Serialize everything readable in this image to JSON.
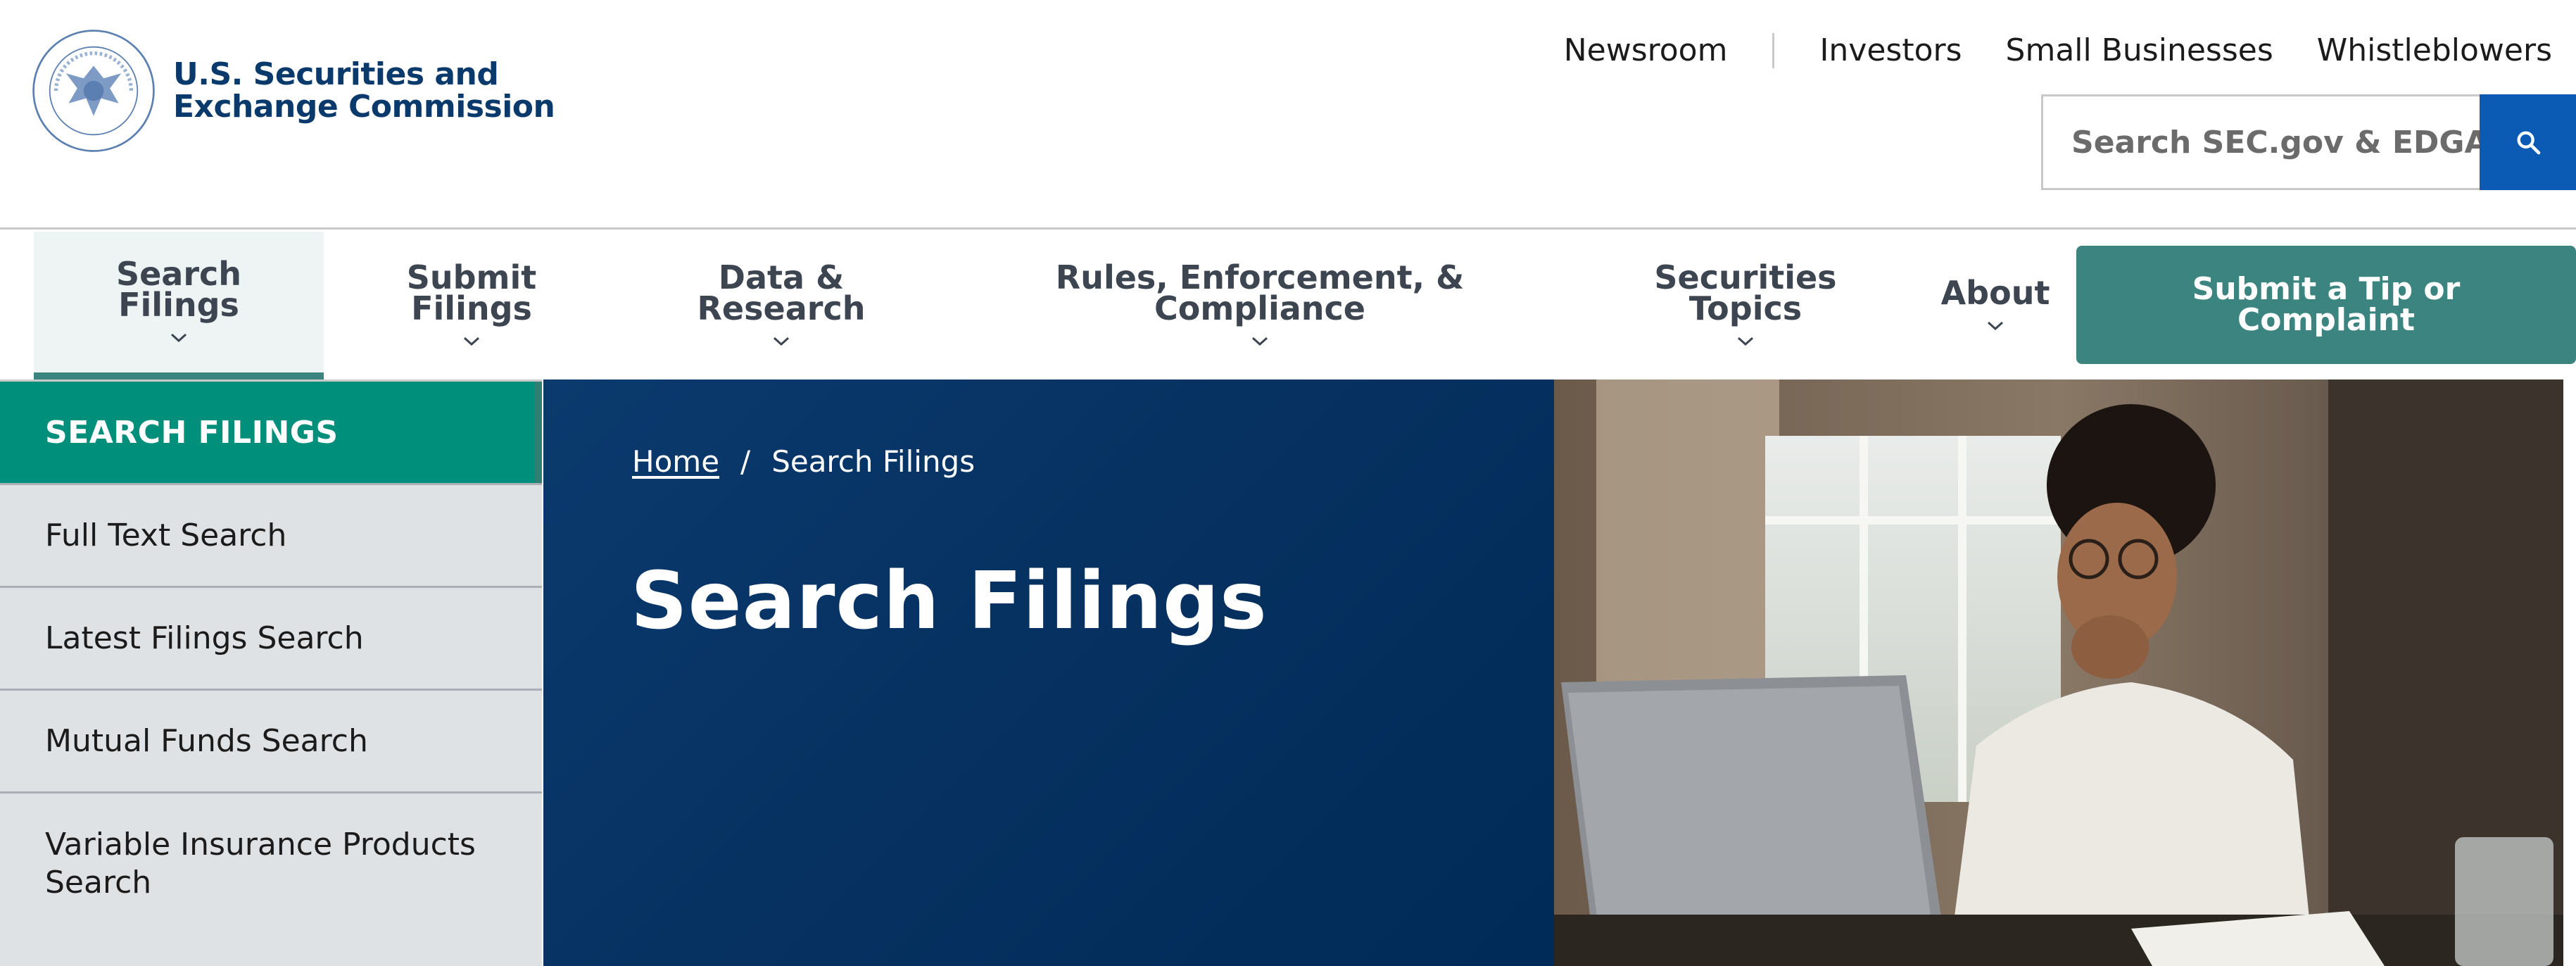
{
  "brand": {
    "name_line1": "U.S. Securities and",
    "name_line2": "Exchange Commission"
  },
  "utility_nav": [
    "Newsroom",
    "Investors",
    "Small Businesses",
    "Whistleblowers"
  ],
  "search": {
    "placeholder": "Search SEC.gov & EDGAR",
    "icon": "search-icon"
  },
  "primary_nav": {
    "items": [
      {
        "line1": "Search",
        "line2": "Filings",
        "active": true
      },
      {
        "line1": "Submit",
        "line2": "Filings"
      },
      {
        "line1": "Data &",
        "line2": "Research"
      },
      {
        "line1": "Rules, Enforcement, &",
        "line2": "Compliance"
      },
      {
        "line1": "Securities",
        "line2": "Topics"
      },
      {
        "line1": "About",
        "line2": ""
      }
    ],
    "cta": {
      "line1": "Submit a Tip or",
      "line2": "Complaint"
    }
  },
  "sidebar": {
    "heading": "SEARCH FILINGS",
    "items": [
      "Full Text Search",
      "Latest Filings Search",
      "Mutual Funds Search",
      "Variable Insurance Products Search"
    ]
  },
  "breadcrumb": {
    "home": "Home",
    "separator": "/",
    "current": "Search Filings"
  },
  "hero": {
    "title": "Search Filings"
  },
  "colors": {
    "brand_navy": "#0a3a6b",
    "hero_navy": "#05305f",
    "teal_cta": "#3b8480",
    "teal_sidebar": "#008f7a",
    "search_blue": "#0b5bb5"
  }
}
